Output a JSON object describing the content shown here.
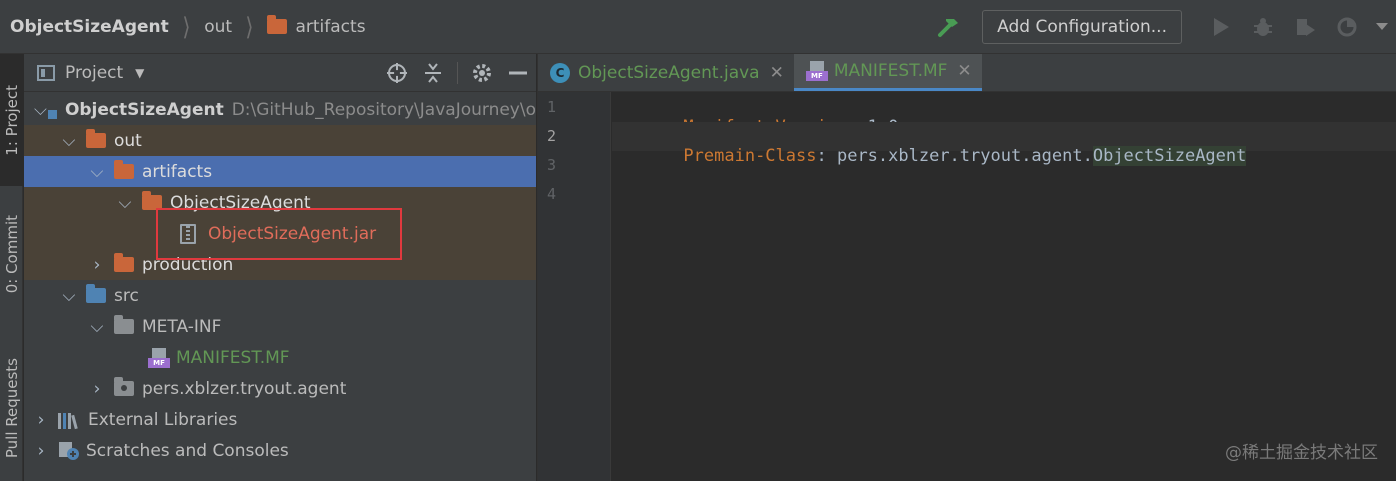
{
  "navbar": {
    "breadcrumbs": [
      "ObjectSizeAgent",
      "out",
      "artifacts"
    ],
    "add_configuration": "Add Configuration..."
  },
  "stripe": {
    "project_tab": "1: Project",
    "commit_tab": "0: Commit",
    "pull_requests_tab": "Pull Requests"
  },
  "project_panel": {
    "title": "Project",
    "tree": [
      {
        "label": "ObjectSizeAgent",
        "path": "D:\\GitHub_Repository\\JavaJourney\\o"
      },
      {
        "label": "out"
      },
      {
        "label": "artifacts"
      },
      {
        "label": "ObjectSizeAgent"
      },
      {
        "label": "ObjectSizeAgent.jar"
      },
      {
        "label": "production"
      },
      {
        "label": "src"
      },
      {
        "label": "META-INF"
      },
      {
        "label": "MANIFEST.MF"
      },
      {
        "label": "pers.xblzer.tryout.agent"
      },
      {
        "label": "External Libraries"
      },
      {
        "label": "Scratches and Consoles"
      }
    ]
  },
  "editor": {
    "tabs": [
      {
        "label": "ObjectSizeAgent.java",
        "icon": "C"
      },
      {
        "label": "MANIFEST.MF",
        "icon": "MF"
      }
    ],
    "line_numbers": [
      "1",
      "2",
      "3",
      "4"
    ],
    "lines": [
      {
        "key": "Manifest-Version",
        "sep": ": ",
        "value": "1.0"
      },
      {
        "key": "Premain-Class",
        "sep": ": ",
        "value_prefix": "pers.xblzer.tryout.agent.",
        "value_class": "ObjectSizeAgent"
      }
    ]
  },
  "watermark": "@稀土掘金技术社区",
  "colors": {
    "selection": "#4b6eaf",
    "excluded_highlight": "#4a4237",
    "annotation_box": "#e0393e",
    "keyword": "#cc7832"
  }
}
